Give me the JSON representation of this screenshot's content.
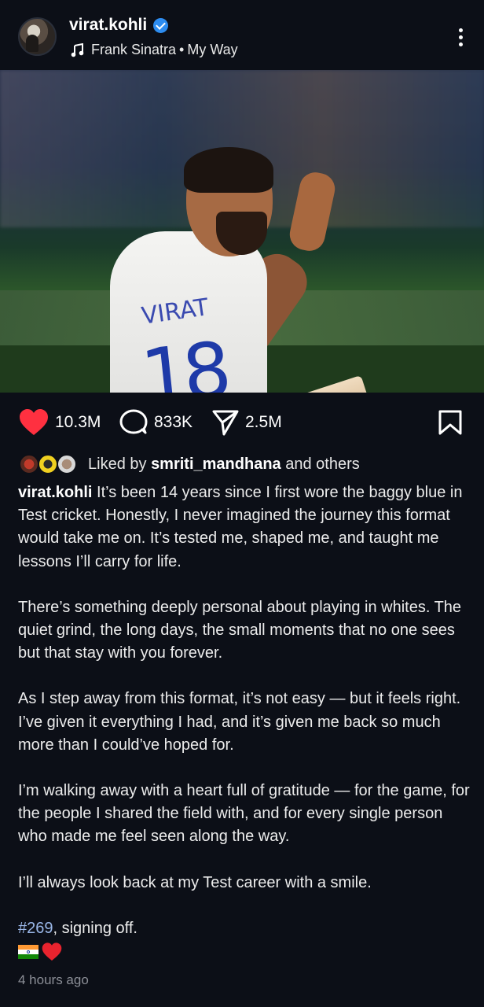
{
  "post": {
    "username": "virat.kohli",
    "verified": true,
    "music": {
      "artist": "Frank Sinatra",
      "separator": "•",
      "song": "My Way"
    },
    "photo": {
      "jersey_name": "VIRAT",
      "jersey_number": "18"
    }
  },
  "actions": {
    "likes": "10.3M",
    "comments": "833K",
    "shares": "2.5M",
    "like_color": "#ff3040"
  },
  "liked_by": {
    "prefix": "Liked by",
    "user": "smriti_mandhana",
    "suffix": "and others"
  },
  "caption": {
    "author": "virat.kohli",
    "paragraphs": [
      "It’s been 14 years since I first wore the baggy blue in Test cricket. Honestly, I never imagined the journey this format would take me on. It’s tested me, shaped me, and taught me lessons I’ll carry for life.",
      "There’s something deeply personal about playing in whites. The quiet grind, the long days, the small moments that no one sees but that stay with you forever.",
      "As I step away from this format, it’s not easy — but it feels right. I’ve given it everything I had, and it’s given me back so much more than I could’ve hoped for.",
      "I’m walking away with a heart full of gratitude — for the game, for the people I shared the field with, and for every single person who made me feel seen along the way.",
      "I’ll always look back at my Test career with a smile."
    ],
    "hashtag": "#269",
    "closing": ", signing off."
  },
  "timestamp": "4 hours ago",
  "icons": [
    "music-note-icon",
    "verified-icon",
    "more-icon",
    "mute-icon",
    "heart-icon",
    "comment-icon",
    "share-icon",
    "bookmark-icon",
    "india-flag-icon",
    "red-heart-icon"
  ]
}
